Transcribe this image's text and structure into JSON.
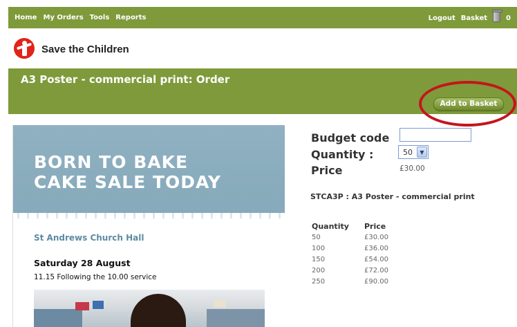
{
  "nav": {
    "items": [
      "Home",
      "My Orders",
      "Tools",
      "Reports"
    ],
    "logout": "Logout",
    "basket_label": "Basket",
    "basket_count": "0"
  },
  "brand": {
    "name": "Save the Children",
    "color": "#e2231a"
  },
  "page": {
    "title": "A3 Poster - commercial print: Order",
    "add_button": "Add to Basket"
  },
  "poster": {
    "headline_line1": "BORN TO BAKE",
    "headline_line2": "CAKE SALE TODAY",
    "venue": "St Andrews Church Hall",
    "date": "Saturday 28 August",
    "time": "11.15 Following the 10.00 service"
  },
  "order_form": {
    "budget_label": "Budget code",
    "budget_value": "",
    "quantity_label": "Quantity :",
    "quantity_value": "50",
    "price_label": "Price",
    "price_value": "£30.00",
    "sku_line": "STCA3P : A3 Poster - commercial print"
  },
  "price_table": {
    "headers": [
      "Quantity",
      "Price"
    ],
    "rows": [
      [
        "50",
        "£30.00"
      ],
      [
        "100",
        "£36.00"
      ],
      [
        "150",
        "£54.00"
      ],
      [
        "200",
        "£72.00"
      ],
      [
        "250",
        "£90.00"
      ]
    ]
  },
  "colors": {
    "accent_green": "#7e9a3a",
    "highlight_ring": "#c4151c",
    "poster_blue": "#8fb1c1"
  }
}
